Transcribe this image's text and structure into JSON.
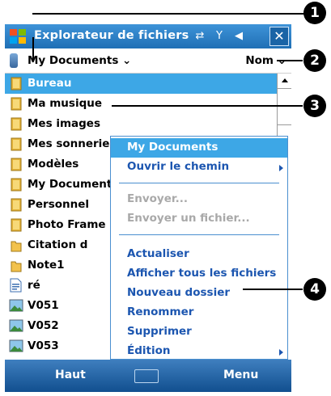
{
  "titlebar": {
    "title": "Explorateur de fichiers",
    "close_label": "✕"
  },
  "pathbar": {
    "path_label": "My Documents ⌄",
    "sort_label": "Nom ⌄"
  },
  "files": [
    {
      "name": "Bureau",
      "type": "folder",
      "selected": true
    },
    {
      "name": "Ma musique",
      "type": "folder"
    },
    {
      "name": "Mes images",
      "type": "folder"
    },
    {
      "name": "Mes sonneries",
      "type": "folder"
    },
    {
      "name": "Modèles",
      "type": "folder"
    },
    {
      "name": "My Documents",
      "type": "folder"
    },
    {
      "name": "Personnel",
      "type": "folder"
    },
    {
      "name": "Photo Frame",
      "type": "folder"
    },
    {
      "name": "Citation d",
      "type": "folder"
    },
    {
      "name": "Note1",
      "type": "folder"
    },
    {
      "name": "ré",
      "type": "document"
    },
    {
      "name": "V051",
      "type": "image"
    },
    {
      "name": "V052",
      "type": "image"
    },
    {
      "name": "V053",
      "type": "image"
    }
  ],
  "context_menu": {
    "items": [
      {
        "label": "My Documents",
        "state": "selected"
      },
      {
        "label": "Ouvrir le chemin",
        "state": "normal",
        "submenu": true
      },
      {
        "label": "Envoyer...",
        "state": "disabled"
      },
      {
        "label": "Envoyer un fichier...",
        "state": "disabled"
      },
      {
        "label": "Actualiser",
        "state": "normal"
      },
      {
        "label": "Afficher tous les fichiers",
        "state": "normal"
      },
      {
        "label": "Nouveau dossier",
        "state": "normal"
      },
      {
        "label": "Renommer",
        "state": "normal"
      },
      {
        "label": "Supprimer",
        "state": "normal"
      },
      {
        "label": "Édition",
        "state": "normal",
        "submenu": true
      }
    ]
  },
  "bottombar": {
    "left_softkey": "Haut",
    "right_softkey": "Menu"
  },
  "callouts": [
    "1",
    "2",
    "3",
    "4"
  ],
  "colors": {
    "titlebar": "#2a80c8",
    "selection": "#3da7e6",
    "menu_text": "#1c56b0",
    "softkey_bar": "#1f5fa0"
  }
}
